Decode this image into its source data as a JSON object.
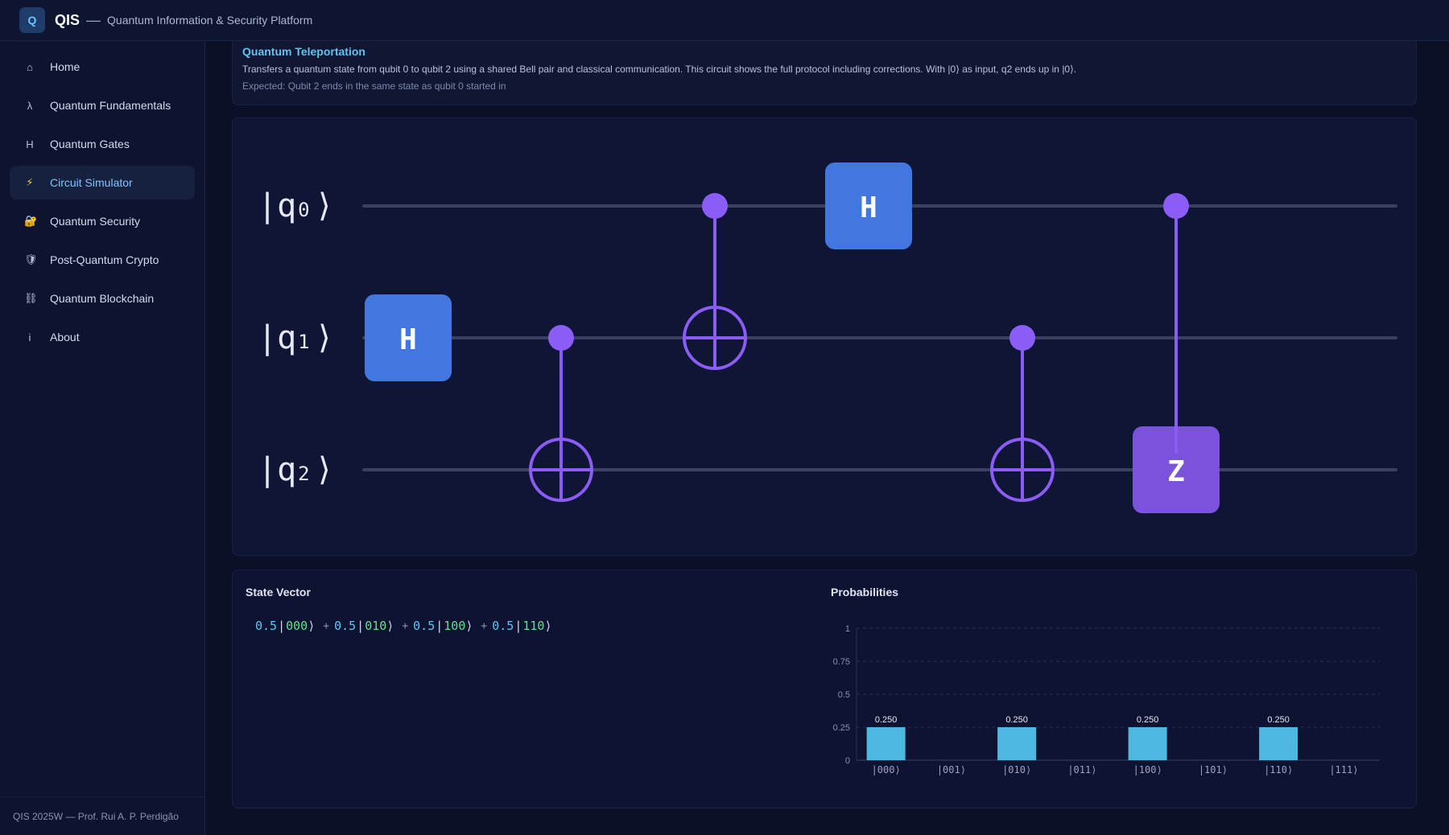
{
  "app": {
    "logo_letter": "Q",
    "title": "QIS",
    "dash": "—",
    "subtitle": "Quantum Information & Security Platform"
  },
  "sidebar": {
    "items": [
      {
        "icon": "⌂",
        "label": "Home",
        "icon_name": "home-icon"
      },
      {
        "icon": "λ",
        "label": "Quantum Fundamentals",
        "icon_name": "lambda-icon"
      },
      {
        "icon": "H",
        "label": "Quantum Gates",
        "icon_name": "hadamard-icon"
      },
      {
        "icon": "⚡",
        "label": "Circuit Simulator",
        "icon_name": "lightning-icon",
        "active": true
      },
      {
        "icon": "🔐",
        "label": "Quantum Security",
        "icon_name": "lock-icon"
      },
      {
        "icon": "🛡",
        "label": "Post-Quantum Crypto",
        "icon_name": "shield-icon"
      },
      {
        "icon": "⛓",
        "label": "Quantum Blockchain",
        "icon_name": "chain-icon"
      },
      {
        "icon": "i",
        "label": "About",
        "icon_name": "info-icon"
      }
    ],
    "footer": "QIS 2025W — Prof. Rui A. P. Perdigão"
  },
  "info": {
    "title": "Quantum Teleportation",
    "description": "Transfers a quantum state from qubit 0 to qubit 2 using a shared Bell pair and classical communication. This circuit shows the full protocol including corrections. With |0⟩ as input, q2 ends up in |0⟩.",
    "expected": "Expected: Qubit 2 ends in the same state as qubit 0 started in"
  },
  "circuit": {
    "qubits": [
      {
        "label": "|q",
        "index": "0",
        "close": "⟩"
      },
      {
        "label": "|q",
        "index": "1",
        "close": "⟩"
      },
      {
        "label": "|q",
        "index": "2",
        "close": "⟩"
      }
    ],
    "gates": [
      {
        "type": "H",
        "label": "H",
        "target": 1,
        "step": 0
      },
      {
        "type": "CNOT",
        "control": 1,
        "target": 2,
        "step": 1
      },
      {
        "type": "CNOT",
        "control": 0,
        "target": 1,
        "step": 2
      },
      {
        "type": "H",
        "label": "H",
        "target": 0,
        "step": 3
      },
      {
        "type": "CNOT",
        "control": 1,
        "target": 2,
        "step": 4
      },
      {
        "type": "CZ",
        "label": "Z",
        "control": 0,
        "target": 2,
        "step": 5
      }
    ],
    "colors": {
      "h_gate": "#4277e0",
      "z_gate": "#7a52dc",
      "control": "#8b5cf6",
      "wire": "#3a4060"
    }
  },
  "state_vector": {
    "title": "State Vector",
    "terms": [
      {
        "coef": "0.5",
        "basis": "000"
      },
      {
        "coef": "0.5",
        "basis": "010"
      },
      {
        "coef": "0.5",
        "basis": "100"
      },
      {
        "coef": "0.5",
        "basis": "110"
      }
    ],
    "plus": "+",
    "bar": "|",
    "ket": "⟩"
  },
  "probabilities": {
    "title": "Probabilities",
    "chart_data": {
      "type": "bar",
      "categories": [
        "|000⟩",
        "|001⟩",
        "|010⟩",
        "|011⟩",
        "|100⟩",
        "|101⟩",
        "|110⟩",
        "|111⟩"
      ],
      "values": [
        0.25,
        0,
        0.25,
        0,
        0.25,
        0,
        0.25,
        0
      ],
      "data_labels": [
        "0.250",
        "",
        "0.250",
        "",
        "0.250",
        "",
        "0.250",
        ""
      ],
      "yticks": [
        "0",
        "0.25",
        "0.5",
        "0.75",
        "1"
      ],
      "ylim": [
        0,
        1
      ],
      "grid": true,
      "bar_color": "#4fb8e0"
    }
  }
}
